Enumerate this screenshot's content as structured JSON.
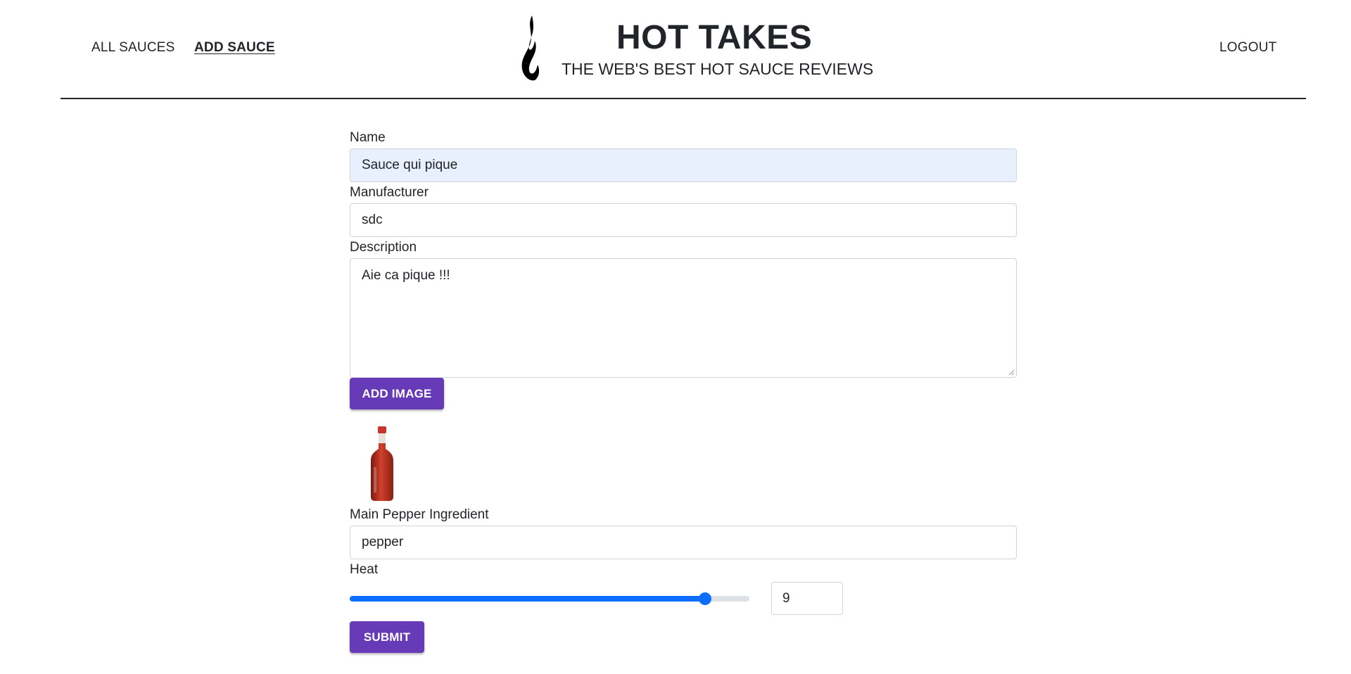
{
  "nav": {
    "all_sauces": "ALL SAUCES",
    "add_sauce": "ADD SAUCE",
    "logout": "LOGOUT"
  },
  "brand": {
    "title": "HOT TAKES",
    "subtitle": "THE WEB'S BEST HOT SAUCE REVIEWS",
    "logo_icon": "flame-icon"
  },
  "form": {
    "name_label": "Name",
    "name_value": "Sauce qui pique",
    "manufacturer_label": "Manufacturer",
    "manufacturer_value": "sdc",
    "description_label": "Description",
    "description_value": "Aie ca pique !!!",
    "add_image_label": "ADD IMAGE",
    "image_preview": "hot-sauce-bottle-image",
    "pepper_label": "Main Pepper Ingredient",
    "pepper_value": "pepper",
    "heat_label": "Heat",
    "heat_value": "9",
    "heat_min": 1,
    "heat_max": 10,
    "submit_label": "SUBMIT"
  },
  "colors": {
    "button": "#673ab7",
    "slider": "#0d6efd",
    "autofill": "#e8f0fe",
    "text": "#212529"
  }
}
